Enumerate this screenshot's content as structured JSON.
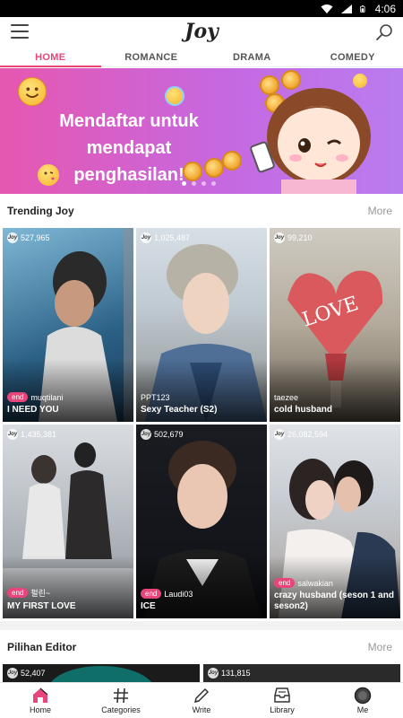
{
  "status_bar": {
    "time": "4:06"
  },
  "header": {
    "logo": "Joy"
  },
  "tabs": [
    {
      "label": "HOME",
      "active": true
    },
    {
      "label": "ROMANCE",
      "active": false
    },
    {
      "label": "DRAMA",
      "active": false
    },
    {
      "label": "COMEDY",
      "active": false
    }
  ],
  "banner": {
    "text_line1": "Mendaftar untuk mendapat",
    "text_line2": "penghasilan!",
    "slide_count": 4,
    "active_slide": 1
  },
  "trending": {
    "title": "Trending Joy",
    "more": "More",
    "cards": [
      {
        "views": "527,965",
        "end": true,
        "author": "muqtilani",
        "title": "I NEED YOU"
      },
      {
        "views": "1,025,487",
        "end": false,
        "author": "PPT123",
        "title": "Sexy Teacher (S2)"
      },
      {
        "views": "99,210",
        "end": false,
        "author": "taezee",
        "title": "cold husband"
      },
      {
        "views": "1,435,381",
        "end": true,
        "author": "펄린~",
        "title": "MY FIRST LOVE"
      },
      {
        "views": "502,679",
        "end": true,
        "author": "Laudi03",
        "title": "ICE"
      },
      {
        "views": "26,082,594",
        "end": true,
        "author": "salwakian",
        "title": "crazy husband (seson 1 and seson2)"
      }
    ]
  },
  "editor": {
    "title": "Pilihan Editor",
    "more": "More",
    "cards": [
      {
        "views": "52,407"
      },
      {
        "views": "131,815"
      }
    ]
  },
  "bottom_nav": [
    {
      "label": "Home",
      "icon": "home-icon",
      "active": true
    },
    {
      "label": "Categories",
      "icon": "hashtag-icon",
      "active": false
    },
    {
      "label": "Write",
      "icon": "pen-icon",
      "active": false
    },
    {
      "label": "Library",
      "icon": "library-tray-icon",
      "active": false
    },
    {
      "label": "Me",
      "icon": "profile-circle-icon",
      "active": false
    }
  ],
  "colors": {
    "accent": "#e8457b",
    "banner_start": "#e657b0",
    "banner_end": "#b97cf0"
  }
}
